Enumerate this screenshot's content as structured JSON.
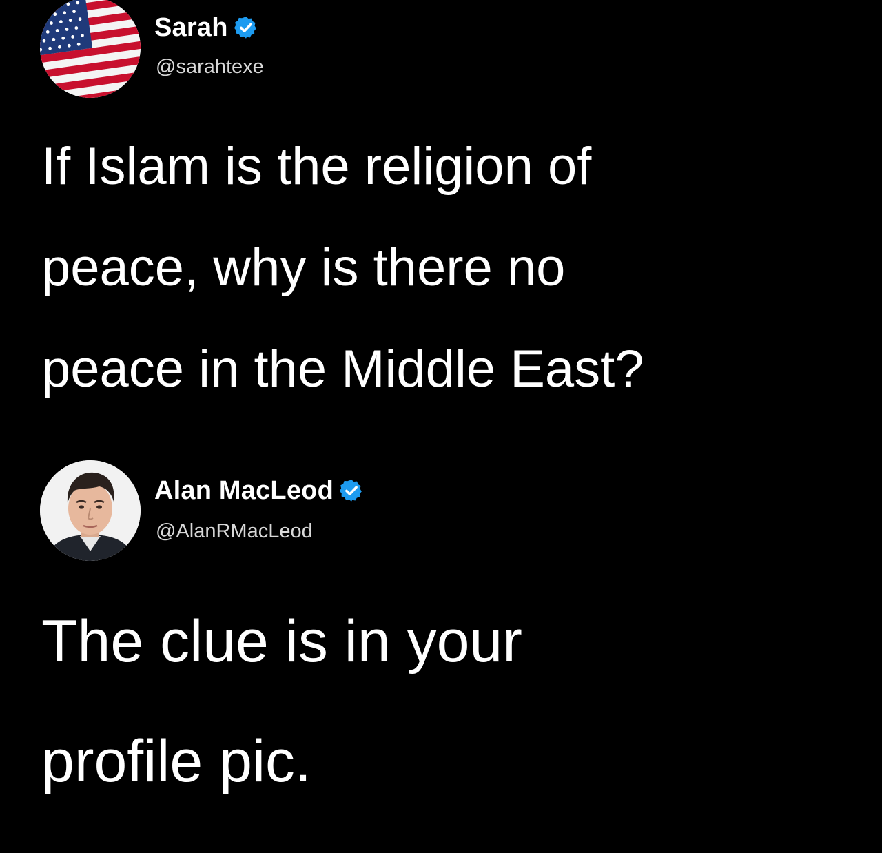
{
  "tweets": [
    {
      "display_name": "Sarah",
      "handle": "@sarahtexe",
      "verified": true,
      "avatar": "american-flag-avatar",
      "text_lines": [
        "If Islam is the religion of",
        "peace, why is there no",
        "peace in the Middle East?"
      ]
    },
    {
      "display_name": "Alan MacLeod",
      "handle": "@AlanRMacLeod",
      "verified": true,
      "avatar": "man-portrait-avatar",
      "text_lines": [
        "The clue is in your",
        "profile pic."
      ]
    }
  ],
  "colors": {
    "background": "#000000",
    "text": "#ffffff",
    "handle": "#d8d8d8",
    "verified_badge": "#1d9bf0",
    "flag_red": "#c8102e",
    "flag_blue": "#1f3a7a"
  }
}
